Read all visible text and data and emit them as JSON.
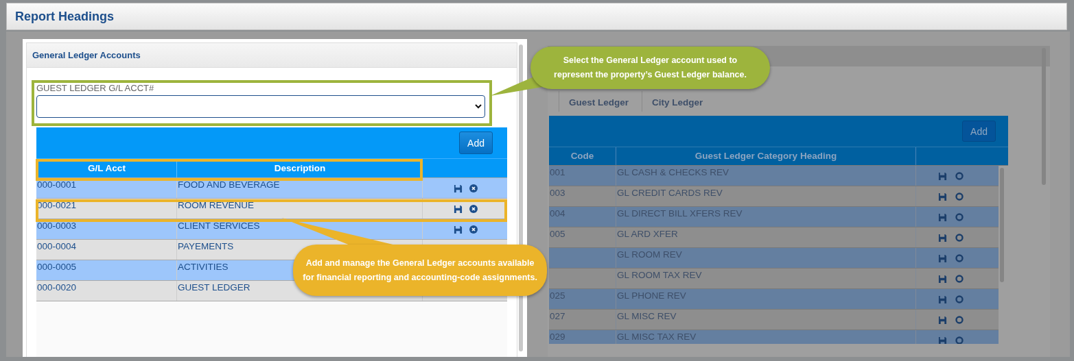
{
  "page": {
    "title": "Report Headings"
  },
  "gl_panel": {
    "title": "General Ledger Accounts",
    "field": {
      "label": "GUEST LEDGER G/L ACCT#"
    },
    "add_button": "Add",
    "columns": [
      "G/L Acct",
      "Description"
    ],
    "rows": [
      {
        "acct": "000-0001",
        "description": "FOOD AND BEVERAGE"
      },
      {
        "acct": "000-0021",
        "description": "ROOM REVENUE"
      },
      {
        "acct": "000-0003",
        "description": "CLIENT SERVICES"
      },
      {
        "acct": "000-0004",
        "description": "PAYEMENTS"
      },
      {
        "acct": "000-0005",
        "description": "ACTIVITIES"
      },
      {
        "acct": "000-0020",
        "description": "GUEST LEDGER"
      }
    ]
  },
  "category_panel": {
    "tabs": [
      {
        "label": "Guest Ledger",
        "selected": true
      },
      {
        "label": "City Ledger",
        "selected": false
      }
    ],
    "add_button": "Add",
    "columns": [
      "Code",
      "Guest Ledger Category Heading"
    ],
    "rows": [
      {
        "code": "001",
        "heading": "GL CASH & CHECKS REV"
      },
      {
        "code": "003",
        "heading": "GL CREDIT CARDS REV"
      },
      {
        "code": "004",
        "heading": "GL DIRECT BILL XFERS REV"
      },
      {
        "code": "005",
        "heading": "GL ARD XFER"
      },
      {
        "heading": "GL ROOM REV"
      },
      {
        "heading": "GL ROOM TAX REV"
      },
      {
        "code": "025",
        "heading": "GL PHONE REV"
      },
      {
        "code": "027",
        "heading": "GL MISC REV"
      },
      {
        "code": "029",
        "heading": "GL MISC TAX REV"
      }
    ]
  },
  "callouts": [
    {
      "text": "Select the General Ledger account used to represent the property’s Guest Ledger balance.",
      "color": "#9db43d"
    },
    {
      "text": "Add and manage the General Ledger accounts available for financial reporting and accounting-code assignments.",
      "color": "#ebb42a"
    }
  ]
}
